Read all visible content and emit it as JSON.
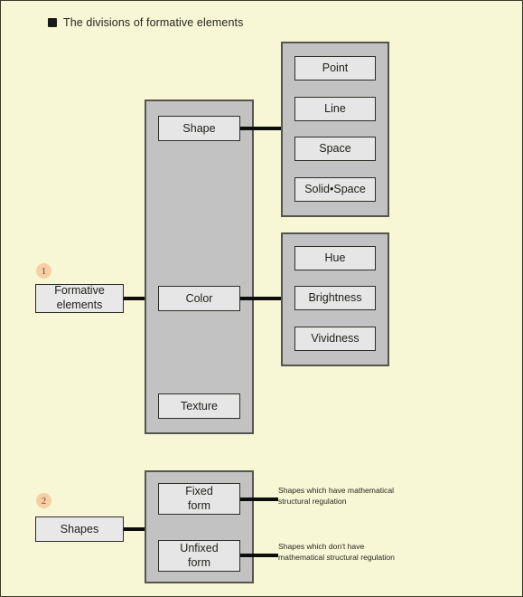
{
  "title": {
    "bullet": "square-bullet",
    "text": "The divisions of formative elements"
  },
  "colors": {
    "background": "#f7f7d5",
    "panel": "#c2c2c2",
    "node": "#e6e6e6",
    "border": "#2d2d28",
    "connector": "#0d0d0d",
    "badge": "#f8cfa4"
  },
  "sections": [
    {
      "badge": "1",
      "root": "Formative elements",
      "root_lines": [
        "Formative",
        "elements"
      ],
      "branches": [
        {
          "label": "Shape",
          "children": [
            "Point",
            "Line",
            "Space",
            "Solid•Space"
          ]
        },
        {
          "label": "Color",
          "children": [
            "Hue",
            "Brightness",
            "Vividness"
          ]
        },
        {
          "label": "Texture",
          "children": []
        }
      ]
    },
    {
      "badge": "2",
      "root": "Shapes",
      "root_lines": [
        "Shapes"
      ],
      "branches": [
        {
          "label": "Fixed form",
          "label_lines": [
            "Fixed",
            "form"
          ],
          "annotation": "Shapes which have mathematical structural regulation"
        },
        {
          "label": "Unfixed form",
          "label_lines": [
            "Unfixed",
            "form"
          ],
          "annotation": "Shapes which don't have mathematical structural regulation"
        }
      ]
    }
  ]
}
